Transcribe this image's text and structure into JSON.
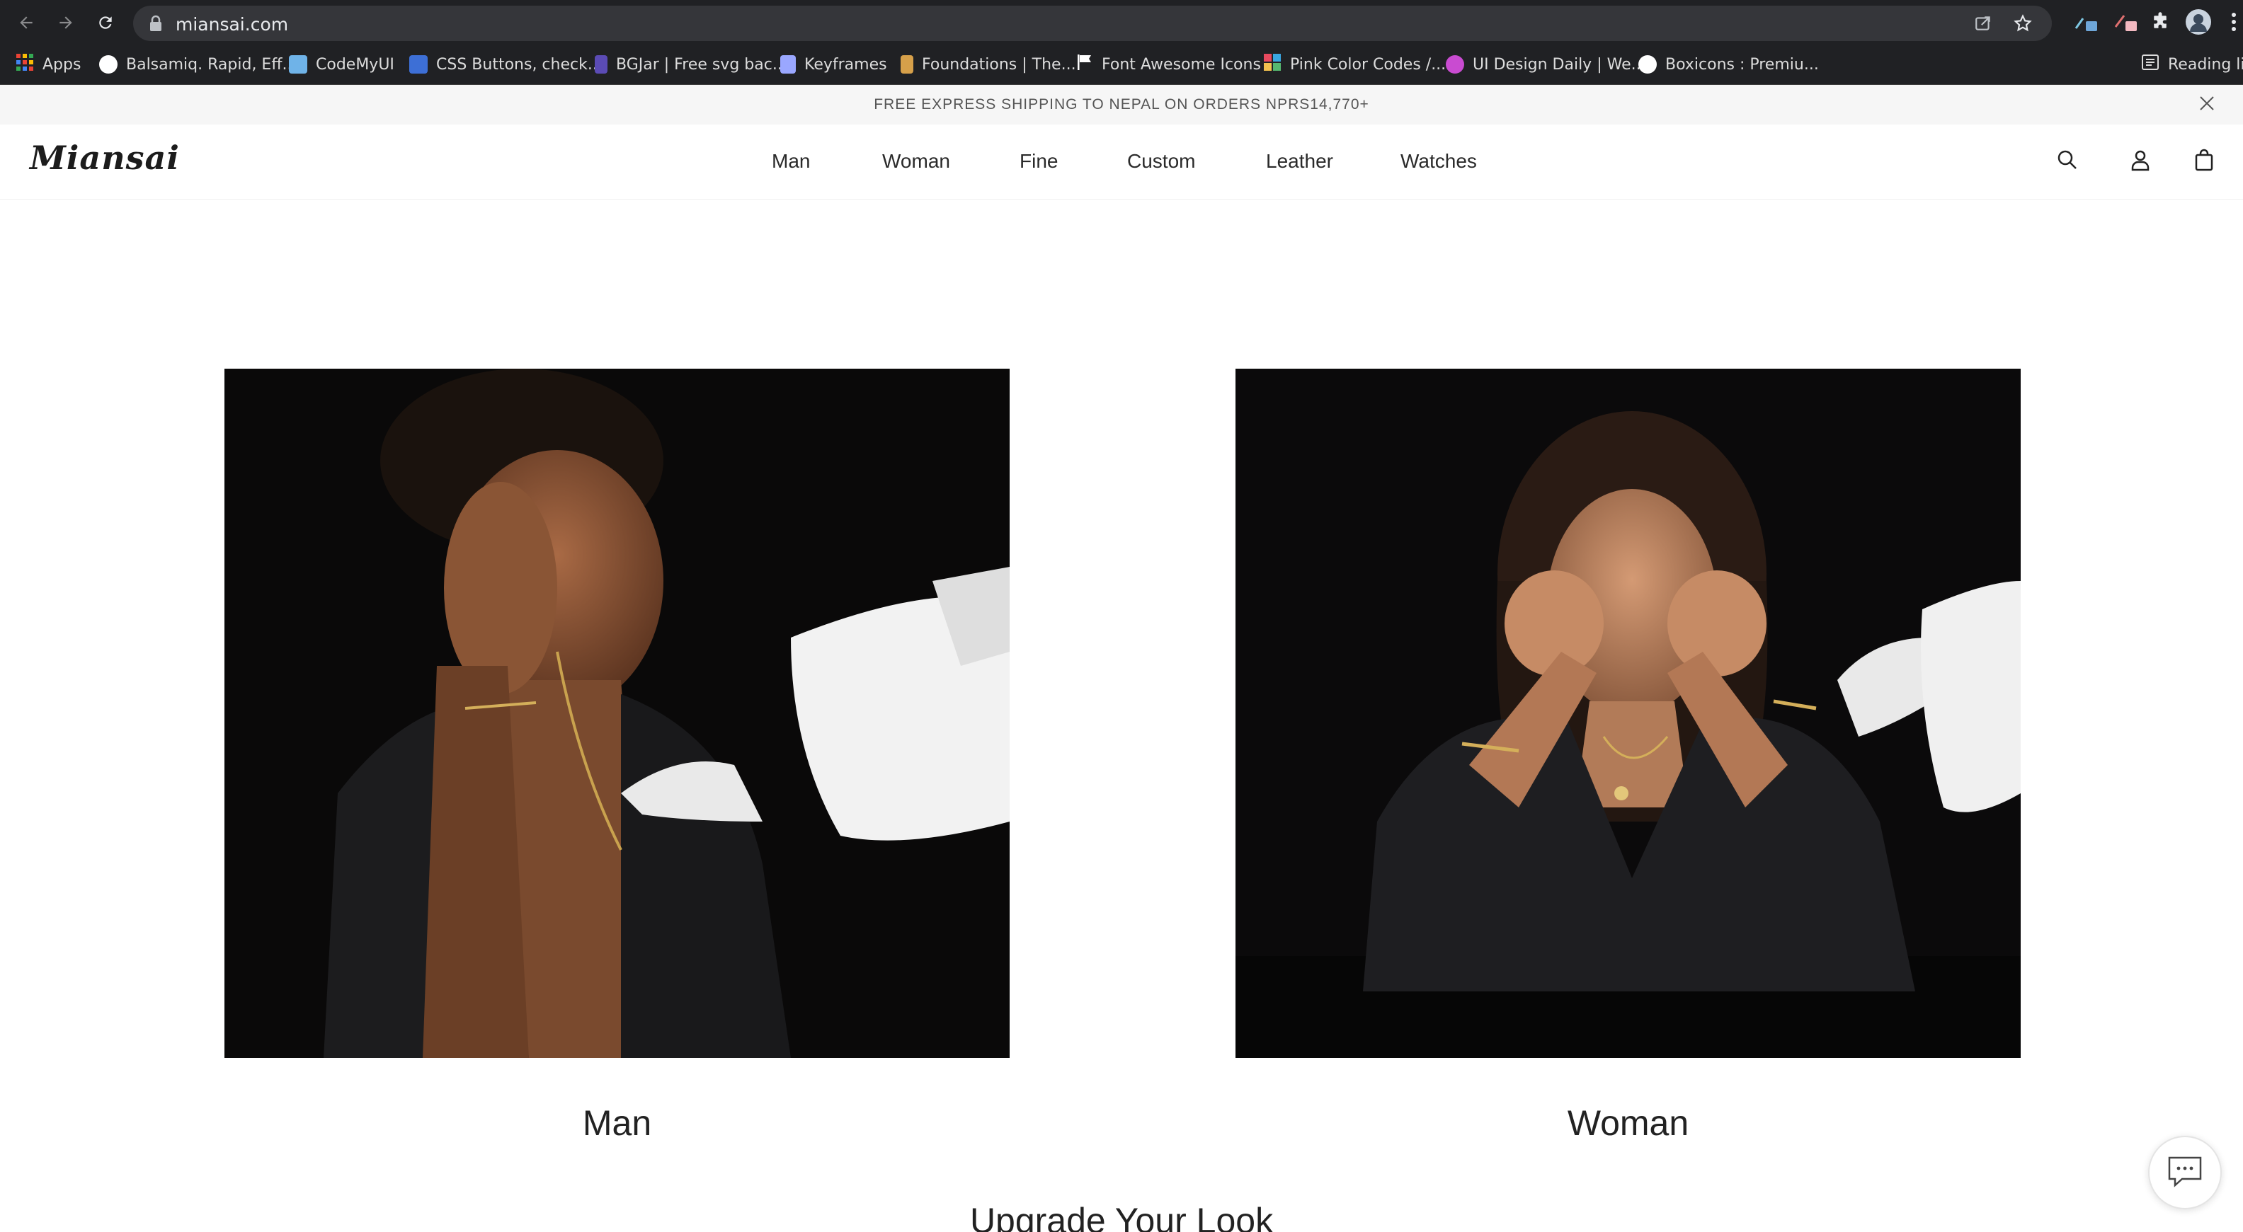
{
  "browser": {
    "url": "miansai.com",
    "bookmarks": [
      {
        "label": "Apps",
        "icon": "apps-grid-icon"
      },
      {
        "label": "Balsamiq. Rapid, Eff...",
        "icon": "balsamiq-icon"
      },
      {
        "label": "CodeMyUI",
        "icon": "codemyui-icon"
      },
      {
        "label": "CSS Buttons, check...",
        "icon": "css-buttons-icon"
      },
      {
        "label": "BGJar | Free svg bac...",
        "icon": "bgjar-icon"
      },
      {
        "label": "Keyframes",
        "icon": "keyframes-icon"
      },
      {
        "label": "Foundations | The...",
        "icon": "foundations-icon"
      },
      {
        "label": "Font Awesome Icons",
        "icon": "font-awesome-flag-icon"
      },
      {
        "label": "Pink Color Codes /...",
        "icon": "color-grid-icon"
      },
      {
        "label": "UI Design Daily | We...",
        "icon": "ui-design-daily-icon"
      },
      {
        "label": "Boxicons : Premiu...",
        "icon": "boxicons-icon"
      }
    ],
    "reading_list": "Reading lis"
  },
  "promo": {
    "text": "FREE EXPRESS SHIPPING TO NEPAL ON ORDERS NPRS14,770+"
  },
  "header": {
    "logo": "Miansai",
    "nav": [
      "Man",
      "Woman",
      "Fine",
      "Custom",
      "Leather",
      "Watches"
    ],
    "icons": [
      "search-icon",
      "account-icon",
      "bag-icon"
    ]
  },
  "cards": [
    {
      "label": "Man"
    },
    {
      "label": "Woman"
    }
  ],
  "section": {
    "title": "Upgrade Your Look"
  },
  "colors": {
    "chrome_bg": "#202124",
    "promo_bg": "#f6f6f6",
    "photo_bg": "#0b0a0a"
  }
}
